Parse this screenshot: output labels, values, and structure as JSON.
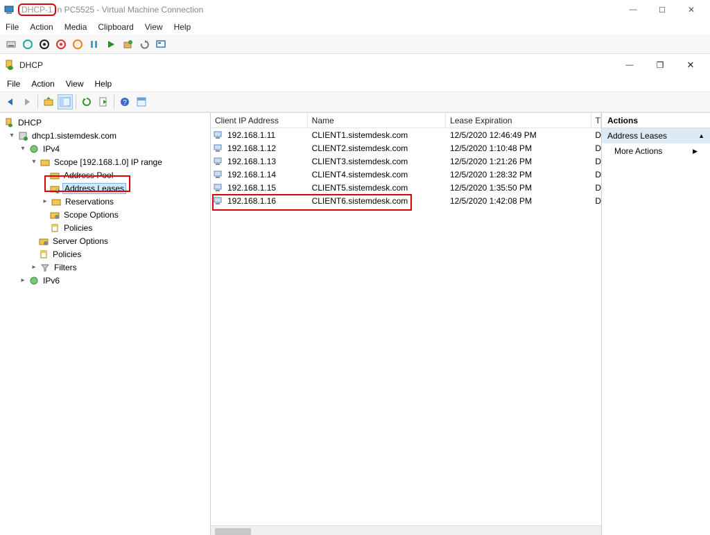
{
  "vm": {
    "title_prefix": "DHCP-1",
    "title_rest": "n PC5525 - Virtual Machine Connection",
    "menu": {
      "file": "File",
      "action": "Action",
      "media": "Media",
      "clipboard": "Clipboard",
      "view": "View",
      "help": "Help"
    }
  },
  "dhcp": {
    "title": "DHCP",
    "menu": {
      "file": "File",
      "action": "Action",
      "view": "View",
      "help": "Help"
    }
  },
  "tree": {
    "root": "DHCP",
    "server": "dhcp1.sistemdesk.com",
    "ipv4": "IPv4",
    "scope": "Scope [192.168.1.0] IP range",
    "address_pool": "Address Pool",
    "address_leases": "Address Leases",
    "reservations": "Reservations",
    "scope_options": "Scope Options",
    "policies": "Policies",
    "server_options": "Server Options",
    "policies2": "Policies",
    "filters": "Filters",
    "ipv6": "IPv6"
  },
  "columns": {
    "ip": "Client IP Address",
    "name": "Name",
    "exp": "Lease Expiration",
    "t": "T"
  },
  "leases": [
    {
      "ip": "192.168.1.11",
      "name": "CLIENT1.sistemdesk.com",
      "exp": "12/5/2020 12:46:49 PM",
      "t": "D"
    },
    {
      "ip": "192.168.1.12",
      "name": "CLIENT2.sistemdesk.com",
      "exp": "12/5/2020 1:10:48 PM",
      "t": "D"
    },
    {
      "ip": "192.168.1.13",
      "name": "CLIENT3.sistemdesk.com",
      "exp": "12/5/2020 1:21:26 PM",
      "t": "D"
    },
    {
      "ip": "192.168.1.14",
      "name": "CLIENT4.sistemdesk.com",
      "exp": "12/5/2020 1:28:32 PM",
      "t": "D"
    },
    {
      "ip": "192.168.1.15",
      "name": "CLIENT5.sistemdesk.com",
      "exp": "12/5/2020 1:35:50 PM",
      "t": "D"
    },
    {
      "ip": "192.168.1.16",
      "name": "CLIENT6.sistemdesk.com",
      "exp": "12/5/2020 1:42:08 PM",
      "t": "D"
    }
  ],
  "actions": {
    "header": "Actions",
    "sub": "Address Leases",
    "more": "More Actions"
  }
}
